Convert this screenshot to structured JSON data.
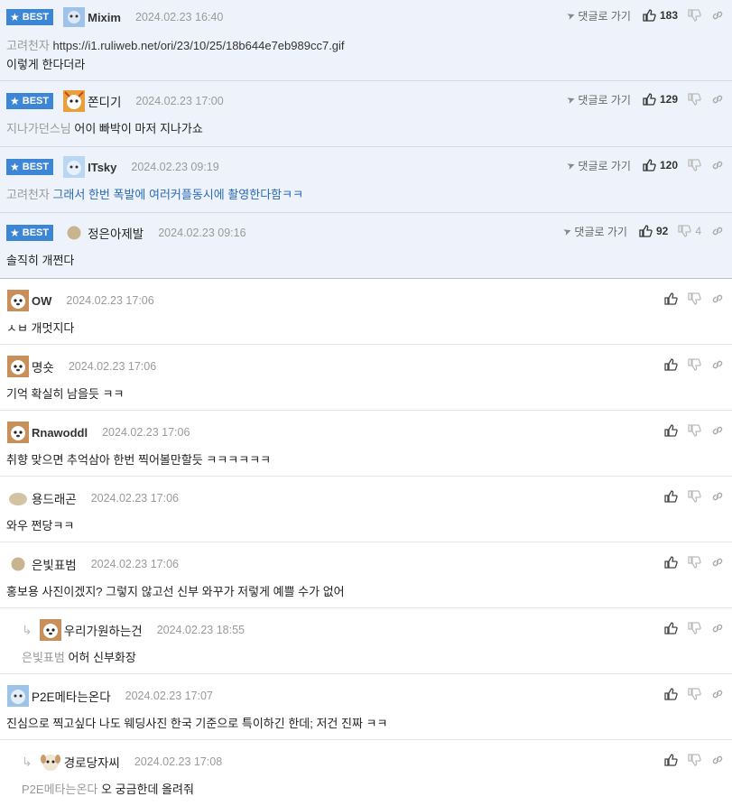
{
  "badge_label": "BEST",
  "goto_label": "댓글로 가기",
  "comments": [
    {
      "best": true,
      "nick": "Mixim",
      "date": "2024.02.23 16:40",
      "likes": "183",
      "mention": "고려천자",
      "text1": "https://i1.ruliweb.net/ori/23/10/25/18b644e7eb989cc7.gif",
      "text2": "이렇게 한다더라"
    },
    {
      "best": true,
      "nick": "쫀디기",
      "date": "2024.02.23 17:00",
      "likes": "129",
      "mention": "지나가던스님",
      "text1": "어이 빠박이 마저 지나가쇼"
    },
    {
      "best": true,
      "nick": "ITsky",
      "date": "2024.02.23 09:19",
      "likes": "120",
      "mention": "고려천자",
      "text1": "그래서 한번 폭발에 여러커플동시에 촬영한다함ㅋㅋ"
    },
    {
      "best": true,
      "nick": "정은아제발",
      "date": "2024.02.23 09:16",
      "likes": "92",
      "dislikes": "4",
      "text1": "솔직히 개쩐다"
    },
    {
      "nick": "OW",
      "date": "2024.02.23 17:06",
      "text1": "ㅅㅂ 개멋지다"
    },
    {
      "nick": "명숏",
      "date": "2024.02.23 17:06",
      "text1": "기억 확실히 남을듯 ㅋㅋ"
    },
    {
      "nick": "Rnawoddl",
      "date": "2024.02.23 17:06",
      "text1": "취향 맞으면 추억삼아 한번 찍어볼만할듯 ㅋㅋㅋㅋㅋㅋ"
    },
    {
      "nick": "용드래곤",
      "date": "2024.02.23 17:06",
      "text1": "와우 쩐당ㅋㅋ"
    },
    {
      "nick": "은빛표범",
      "date": "2024.02.23 17:06",
      "text1": "홍보용 사진이겠지? 그렇지 않고선 신부 와꾸가 저렇게 예쁠 수가 없어"
    },
    {
      "reply": true,
      "nick": "우리가원하는건",
      "date": "2024.02.23 18:55",
      "mention": "은빛표범",
      "text1": "어허 신부화장"
    },
    {
      "nick": "P2E메타는온다",
      "date": "2024.02.23 17:07",
      "text1": "진심으로 찍고싶다 나도 웨딩사진 한국 기준으로 특이하긴 한데; 저건 진짜 ㅋㅋ"
    },
    {
      "reply": true,
      "nick": "경로당자씨",
      "date": "2024.02.23 17:08",
      "mention": "P2E메타는온다",
      "text1": "오 궁금한데 올려줘"
    }
  ]
}
